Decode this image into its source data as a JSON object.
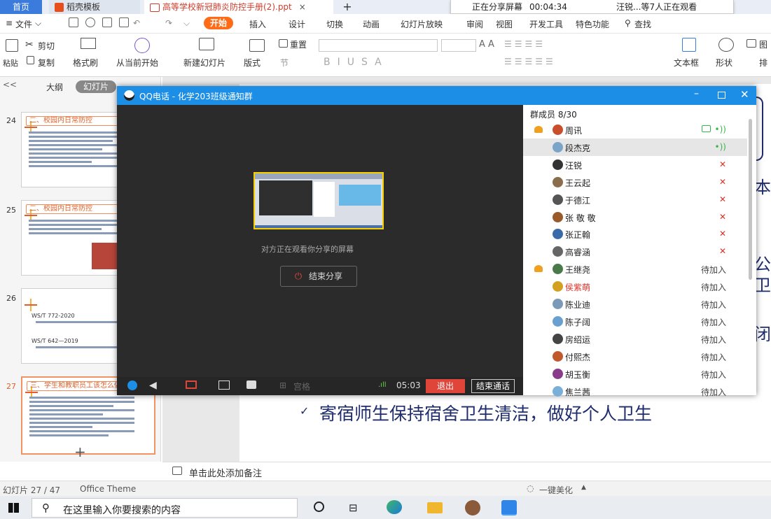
{
  "tabs": {
    "home": "首页",
    "daoke": "稻壳模板",
    "document": "高等学校新冠肺炎防控手册(2).ppt",
    "close": "×",
    "new_tab": "+"
  },
  "share_bar": {
    "status": "正在分享屏幕",
    "timer": "00:04:34",
    "viewers": "汪锐...等7人正在观看"
  },
  "menu": {
    "file": "文件",
    "start": "开始",
    "items": [
      "插入",
      "设计",
      "切换",
      "动画",
      "幻灯片放映",
      "审阅",
      "视图",
      "开发工具",
      "特色功能"
    ],
    "search": "查找"
  },
  "ribbon": {
    "paste": "粘贴",
    "cut": "剪切",
    "copy": "复制",
    "format_painter": "格式刷",
    "from_current": "从当前开始",
    "new_slide": "新建幻灯片",
    "layout": "版式",
    "section": "节",
    "reset": "重置",
    "textbox": "文本框",
    "shape": "形状",
    "picture": "图",
    "arrange": "排"
  },
  "left_pane": {
    "collapse": "<<",
    "outline_tab": "大纲",
    "slides_tab": "幻灯片",
    "add": "+",
    "slides": [
      {
        "num": "24",
        "title": "二、校园内日常防控",
        "sub": ""
      },
      {
        "num": "25",
        "title": "二、校园内日常防控",
        "sub": ""
      },
      {
        "num": "26",
        "title": "",
        "sub1": "WS/T 772-2020",
        "sub2": "WS/T 642—2019"
      },
      {
        "num": "27",
        "title": "三、学生和教职员工该怎么做",
        "sub": ""
      }
    ]
  },
  "slide_text": {
    "right1": "本",
    "right2": "公",
    "right3": "卫",
    "right4": "闭",
    "bottom": "寄宿师生保持宿舍卫生清洁，做好个人卫生",
    "check": "✓"
  },
  "notes": {
    "placeholder": "单击此处添加备注"
  },
  "status": {
    "slide_info": "幻灯片 27 / 47",
    "theme": "Office Theme",
    "beautify": "一键美化"
  },
  "taskbar": {
    "search_placeholder": "在这里输入你要搜索的内容"
  },
  "qq": {
    "title": "QQ电话 - 化学203班级通知群",
    "watching": "对方正在观看你分享的屏幕",
    "end_share": "结束分享",
    "call_time": "05:03",
    "exit": "退出",
    "end_call": "结束通话",
    "grid_label": "宫格",
    "members_header": "群成员 8/30",
    "members": [
      {
        "name": "周讯",
        "status": "",
        "admin": true,
        "color": "#c94f2c"
      },
      {
        "name": "段杰克",
        "status": "",
        "admin": false,
        "color": "#7aa4c8"
      },
      {
        "name": "汪锐",
        "status": "",
        "admin": false,
        "color": "#333333"
      },
      {
        "name": "王云起",
        "status": "",
        "admin": false,
        "color": "#8a6d4b"
      },
      {
        "name": "于德江",
        "status": "",
        "admin": false,
        "color": "#555555"
      },
      {
        "name": "张 敬 敬",
        "status": "",
        "admin": false,
        "color": "#9b5a2a"
      },
      {
        "name": "张正翰",
        "status": "",
        "admin": false,
        "color": "#3a6aa8"
      },
      {
        "name": "高睿涵",
        "status": "",
        "admin": false,
        "color": "#666666"
      },
      {
        "name": "王继尧",
        "status": "待加入",
        "admin": true,
        "color": "#4a7a4a"
      },
      {
        "name": "侯紫萌",
        "status": "待加入",
        "admin": false,
        "color": "#d4a020",
        "red": true
      },
      {
        "name": "陈业迪",
        "status": "待加入",
        "admin": false,
        "color": "#7a9ab8"
      },
      {
        "name": "陈子阔",
        "status": "待加入",
        "admin": false,
        "color": "#6aa0d0"
      },
      {
        "name": "房绍运",
        "status": "待加入",
        "admin": false,
        "color": "#444444"
      },
      {
        "name": "付熙杰",
        "status": "待加入",
        "admin": false,
        "color": "#c05a2a"
      },
      {
        "name": "胡玉衡",
        "status": "待加入",
        "admin": false,
        "color": "#8a3a8a"
      },
      {
        "name": "焦兰茜",
        "status": "待加入",
        "admin": false,
        "color": "#7ab0d8"
      }
    ]
  },
  "colors": {
    "qq_blue": "#1c8ee6",
    "wps_orange": "#ff6b16",
    "exit_red": "#e0453a",
    "slide_text": "#1f2d6e"
  }
}
